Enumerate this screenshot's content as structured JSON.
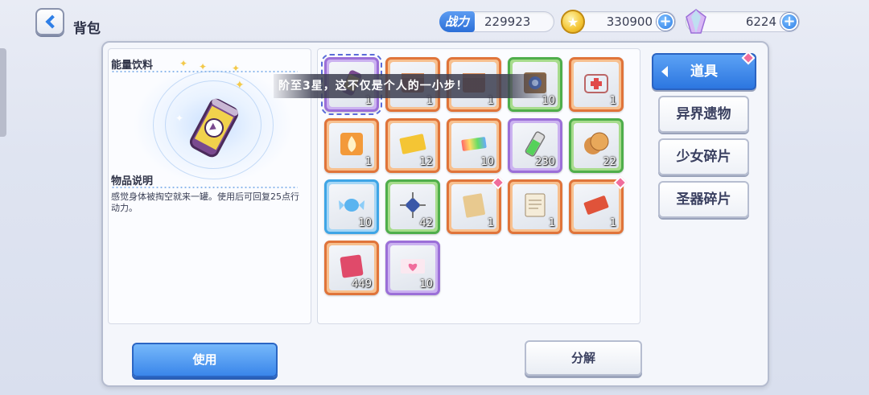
{
  "header": {
    "title": "背包",
    "power_label": "战力",
    "power_value": "229923",
    "coins": "330900",
    "gems": "6224"
  },
  "detail": {
    "item_name": "能量饮料",
    "desc_title": "物品说明",
    "desc_text": "感觉身体被掏空就来一罐。使用后可回复25点行动力。"
  },
  "toast": "阶至3星，这不仅是个人的一小步！",
  "items": [
    {
      "qty": "1",
      "rarity": "purple",
      "icon": "energy-drink-icon",
      "selected": true,
      "new": false
    },
    {
      "qty": "1",
      "rarity": "orange",
      "icon": "crate-icon",
      "selected": false,
      "new": false
    },
    {
      "qty": "1",
      "rarity": "orange",
      "icon": "crate-icon",
      "selected": false,
      "new": false
    },
    {
      "qty": "10",
      "rarity": "green",
      "icon": "blue-crate-icon",
      "selected": false,
      "new": false
    },
    {
      "qty": "1",
      "rarity": "orange",
      "icon": "medkit-icon",
      "selected": false,
      "new": false
    },
    {
      "qty": "1",
      "rarity": "orange",
      "icon": "fire-box-icon",
      "selected": false,
      "new": false
    },
    {
      "qty": "12",
      "rarity": "orange",
      "icon": "gold-ticket-icon",
      "selected": false,
      "new": false
    },
    {
      "qty": "10",
      "rarity": "orange",
      "icon": "rainbow-ticket-icon",
      "selected": false,
      "new": false
    },
    {
      "qty": "230",
      "rarity": "purple",
      "icon": "green-battery-icon",
      "selected": false,
      "new": false
    },
    {
      "qty": "22",
      "rarity": "green",
      "icon": "cookie-icon",
      "selected": false,
      "new": false
    },
    {
      "qty": "10",
      "rarity": "blue",
      "icon": "candy-icon",
      "selected": false,
      "new": false
    },
    {
      "qty": "42",
      "rarity": "green",
      "icon": "chip-icon",
      "selected": false,
      "new": false
    },
    {
      "qty": "1",
      "rarity": "orange",
      "icon": "envelope-icon",
      "selected": false,
      "new": true
    },
    {
      "qty": "1",
      "rarity": "orange",
      "icon": "document-icon",
      "selected": false,
      "new": false
    },
    {
      "qty": "1",
      "rarity": "orange",
      "icon": "red-ticket-icon",
      "selected": false,
      "new": true
    },
    {
      "qty": "449",
      "rarity": "orange",
      "icon": "red-cloth-icon",
      "selected": false,
      "new": false
    },
    {
      "qty": "10",
      "rarity": "purple",
      "icon": "heart-ticket-icon",
      "selected": false,
      "new": false
    }
  ],
  "categories": [
    {
      "label": "道具",
      "active": true,
      "new": true
    },
    {
      "label": "异界遗物",
      "active": false,
      "new": false
    },
    {
      "label": "少女碎片",
      "active": false,
      "new": false
    },
    {
      "label": "圣器碎片",
      "active": false,
      "new": false
    }
  ],
  "actions": {
    "use_label": "使用",
    "split_label": "分解"
  },
  "colors": {
    "accent": "#2f7fe6",
    "orange_rarity": "#e0743a",
    "green_rarity": "#4fae4b",
    "purple_rarity": "#9b6fd8",
    "blue_rarity": "#3ea5e6",
    "new_pip": "#f06d9c"
  }
}
